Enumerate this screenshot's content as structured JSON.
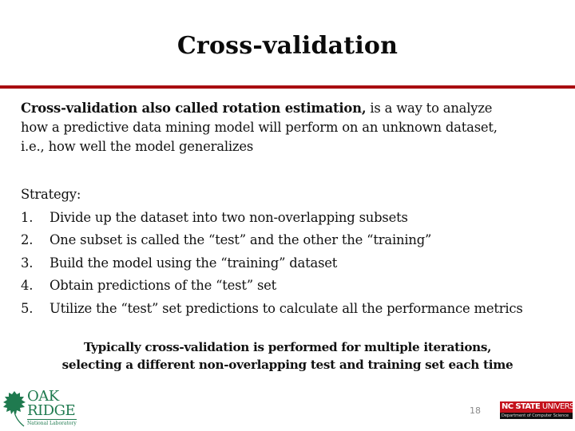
{
  "slide": {
    "title": "Cross-validation",
    "accent_color": "#a80d10",
    "intro": {
      "bold_part": "Cross-validation also called rotation estimation,",
      "line1_rest": " is a way to analyze",
      "line2": "how a predictive data mining model will perform on an unknown dataset,",
      "line3": "i.e., how well the model generalizes"
    },
    "strategy": {
      "heading": "Strategy:",
      "steps": [
        {
          "num": "1.",
          "text": "Divide up the dataset into two non-overlapping subsets"
        },
        {
          "num": "2.",
          "text": "One subset is called the “test” and the other the “training”"
        },
        {
          "num": "3.",
          "text": "Build the model using the “training” dataset"
        },
        {
          "num": "4.",
          "text": "Obtain predictions of the “test” set"
        },
        {
          "num": "5.",
          "text": "Utilize the “test” set predictions to calculate all the performance metrics"
        }
      ]
    },
    "summary": {
      "line1": "Typically cross-validation is performed for multiple iterations,",
      "line2": "selecting a different non-overlapping test and training set each time"
    }
  },
  "footer": {
    "page_number": "18",
    "left_logo": {
      "icon": "oak-leaf-icon",
      "line1": "OAK",
      "line2": "RIDGE",
      "subtitle": "National Laboratory",
      "color": "#1f7a4f"
    },
    "right_logo": {
      "name_bold": "NC STATE",
      "name_rest": " UNIVERSITY",
      "department": "Department of Computer Science",
      "color": "#c4121c"
    }
  }
}
